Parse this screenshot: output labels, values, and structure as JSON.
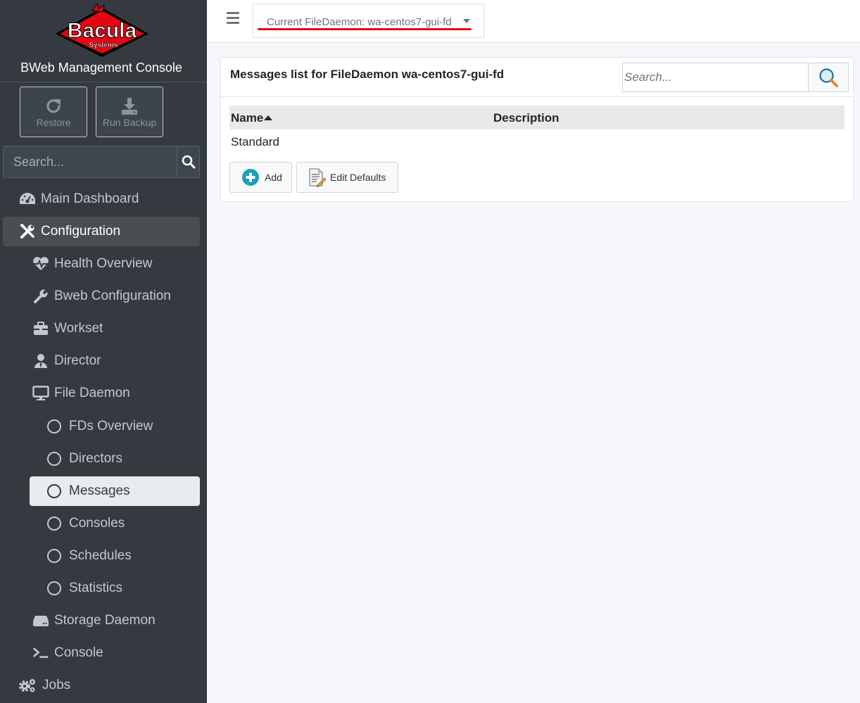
{
  "brand": {
    "logo_text": "Bacula",
    "logo_subtext": "Systems",
    "console_title": "BWeb Management Console"
  },
  "sidebar": {
    "actions": [
      {
        "label": "Restore",
        "icon": "redo-icon"
      },
      {
        "label": "Run Backup",
        "icon": "download-icon"
      }
    ],
    "search_placeholder": "Search...",
    "items": [
      {
        "label": "Main Dashboard",
        "icon": "dashboard-icon"
      },
      {
        "label": "Configuration",
        "icon": "tools-icon",
        "expanded": true
      },
      {
        "label": "Health Overview",
        "icon": "heartbeat-icon"
      },
      {
        "label": "Bweb Configuration",
        "icon": "wrench-icon"
      },
      {
        "label": "Workset",
        "icon": "briefcase-icon"
      },
      {
        "label": "Director",
        "icon": "user-tie-icon"
      },
      {
        "label": "File Daemon",
        "icon": "desktop-icon",
        "expanded": true
      },
      {
        "label": "FDs Overview",
        "icon": "circle-icon"
      },
      {
        "label": "Directors",
        "icon": "circle-icon"
      },
      {
        "label": "Messages",
        "icon": "circle-icon",
        "active": true
      },
      {
        "label": "Consoles",
        "icon": "circle-icon"
      },
      {
        "label": "Schedules",
        "icon": "circle-icon"
      },
      {
        "label": "Statistics",
        "icon": "circle-icon"
      },
      {
        "label": "Storage Daemon",
        "icon": "hdd-icon"
      },
      {
        "label": "Console",
        "icon": "terminal-icon"
      },
      {
        "label": "Jobs",
        "icon": "cogs-icon"
      }
    ]
  },
  "topbar": {
    "fd_selector": "Current FileDaemon: wa-centos7-gui-fd"
  },
  "main": {
    "title": "Messages list for FileDaemon wa-centos7-gui-fd",
    "search_placeholder": "Search...",
    "table": {
      "columns": [
        "Name",
        "Description"
      ],
      "sort": {
        "column": "Name",
        "direction": "ascending"
      },
      "rows": [
        {
          "name": "Standard",
          "description": ""
        }
      ]
    },
    "buttons": {
      "add": "Add",
      "edit_defaults": "Edit Defaults"
    }
  },
  "colors": {
    "sidebar_bg": "#343a40",
    "active_item_bg": "#e9ecef",
    "brand_red": "#e30613",
    "add_icon": "#17a2b8"
  }
}
